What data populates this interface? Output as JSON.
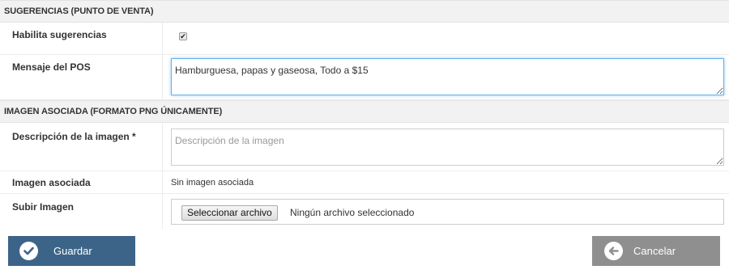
{
  "sections": {
    "suggestions_title": "SUGERENCIAS (PUNTO DE VENTA)",
    "image_title": "IMAGEN ASOCIADA (FORMATO PNG ÚNICAMENTE)"
  },
  "suggestions": {
    "enable_label": "Habilita sugerencias",
    "enable_checked": true,
    "pos_message_label": "Mensaje del POS",
    "pos_message_value": "Hamburguesa, papas y gaseosa, Todo a $15"
  },
  "image": {
    "description_label": "Descripción de la imagen *",
    "description_placeholder": "Descripción de la imagen",
    "associated_label": "Imagen asociada",
    "associated_value": "Sin imagen asociada",
    "upload_label": "Subir Imagen",
    "file_button_label": "Seleccionar archivo",
    "file_status": "Ningún archivo seleccionado"
  },
  "actions": {
    "save_label": "Guardar",
    "cancel_label": "Cancelar"
  },
  "colors": {
    "save_button": "#3c6488",
    "cancel_button": "#8f8f8f",
    "focus_border": "#66afe9"
  },
  "icons": {
    "save": "check-circle-icon",
    "cancel": "arrow-left-circle-icon",
    "checkbox": "checkmark-icon"
  }
}
